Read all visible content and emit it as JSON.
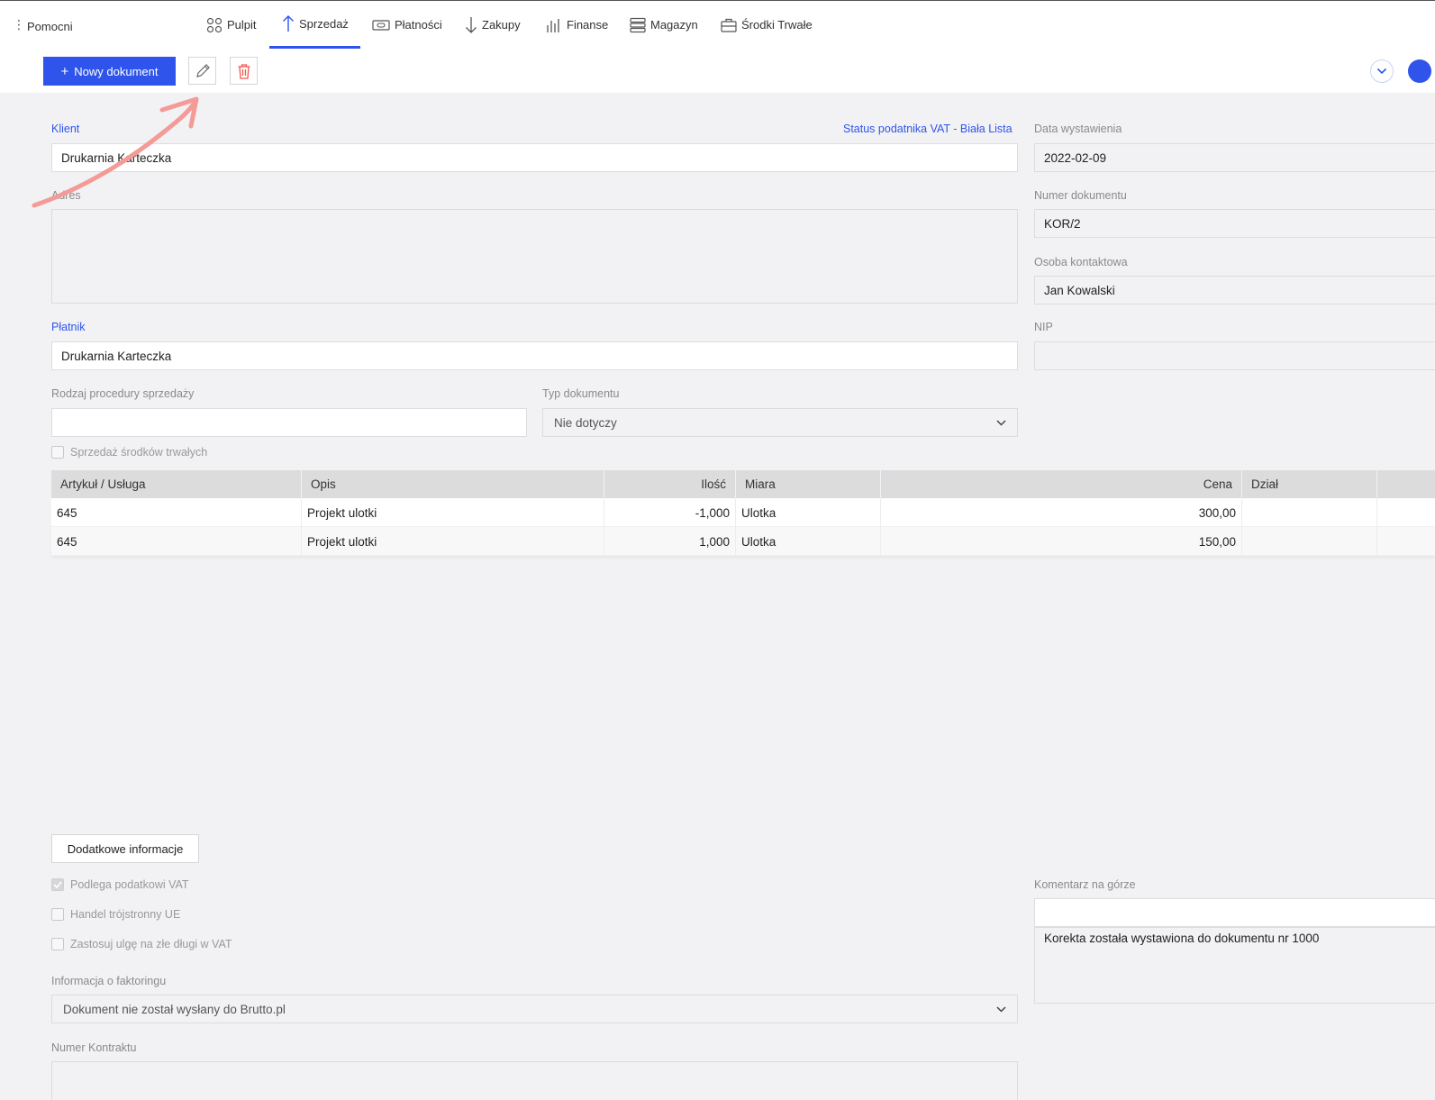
{
  "nav": {
    "helpers_label": "Pomocni",
    "items": [
      {
        "label": "Pulpit",
        "icon": "grid-circles-icon"
      },
      {
        "label": "Sprzedaż",
        "icon": "arrow-up-icon",
        "active": true
      },
      {
        "label": "Płatności",
        "icon": "money-bill-icon"
      },
      {
        "label": "Zakupy",
        "icon": "arrow-down-icon"
      },
      {
        "label": "Finanse",
        "icon": "bar-chart-icon"
      },
      {
        "label": "Magazyn",
        "icon": "stack-icon"
      },
      {
        "label": "Środki Trwałe",
        "icon": "briefcase-icon"
      }
    ]
  },
  "toolbar": {
    "new_document_label": "Nowy dokument"
  },
  "form": {
    "client_label": "Klient",
    "client_value": "Drukarnia Karteczka",
    "vat_status_link": "Status podatnika VAT - Biała Lista",
    "address_label": "Adres",
    "address_value": "",
    "payer_label": "Płatnik",
    "payer_value": "Drukarnia Karteczka",
    "procedure_label": "Rodzaj procedury sprzedaży",
    "procedure_value": "",
    "doc_type_label": "Typ dokumentu",
    "doc_type_value": "Nie dotyczy",
    "fixed_assets_label": "Sprzedaż środków trwałych",
    "issue_date_label": "Data wystawienia",
    "issue_date_value": "2022-02-09",
    "doc_number_label": "Numer dokumentu",
    "doc_number_value": "KOR/2",
    "contact_label": "Osoba kontaktowa",
    "contact_value": "Jan Kowalski",
    "nip_label": "NIP",
    "nip_value": ""
  },
  "table": {
    "headers": [
      "Artykuł / Usługa",
      "Opis",
      "Ilość",
      "Miara",
      "Cena",
      "Dział"
    ],
    "rows": [
      {
        "item": "645",
        "desc": "Projekt ulotki",
        "qty": "-1,000",
        "unit": "Ulotka",
        "price": "300,00",
        "dept": ""
      },
      {
        "item": "645",
        "desc": "Projekt ulotki",
        "qty": "1,000",
        "unit": "Ulotka",
        "price": "150,00",
        "dept": ""
      }
    ]
  },
  "extra": {
    "more_info_label": "Dodatkowe informacje",
    "vat_subject_label": "Podlega podatkowi VAT",
    "triangular_label": "Handel trójstronny UE",
    "bad_debt_label": "Zastosuj ulgę na złe długi w VAT",
    "factoring_label": "Informacja o faktoringu",
    "factoring_value": "Dokument nie został wysłany do Brutto.pl",
    "contract_label": "Numer Kontraktu",
    "comment_top_label": "Komentarz na górze",
    "comment_top_value": "",
    "comment_text": "Korekta została wystawiona do dokumentu nr 1000"
  },
  "colors": {
    "accent": "#2f54eb",
    "danger": "#f5554a",
    "annotation_arrow": "#f49a97"
  }
}
